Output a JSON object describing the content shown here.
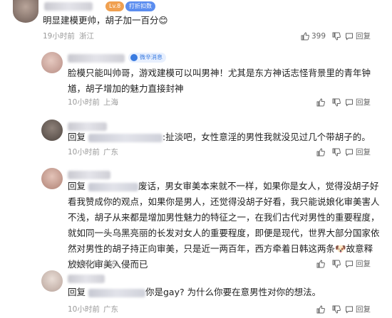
{
  "comments": [
    {
      "level_badge": "Lv.8",
      "tag_badge": "打折扣数",
      "text": "明显建模更帅，胡子加一百分",
      "emoji": "😊",
      "time": "19小时前",
      "location": "浙江",
      "likes": "399",
      "reply_label": "回复"
    },
    {
      "tag_badge": "微辛消息",
      "text": "脸模只能叫帅哥，游戏建模可以叫男神！尤其是东方神话志怪背景里的青年钟馗，胡子增加的魅力直接封神",
      "time": "10小时前",
      "location": "上海",
      "likes": "",
      "reply_label": "回复"
    },
    {
      "reply_prefix": "回复",
      "text": ":扯淡吧，女性意淫的男性我就没见过几个带胡子的。",
      "time": "10小时前",
      "location": "广东",
      "likes": "",
      "reply_label": "回复"
    },
    {
      "reply_prefix": "回复",
      "text": "废话，男女审美本来就不一样，如果你是女人，觉得没胡子好看我赞成你的观点，如果你是男人，还觉得没胡子好看，我只能说娘化审美害人不浅，胡子从来都是增加男性魅力的特征之一，在我们古代对男性的重要程度，就如同一头乌黑亮丽的长发对女人的重要程度，即便是现代，世界大部分国家依然对男性的胡子持正向审美，只是近一两百年，西方牵着日韩这两条",
      "text_tail": "故意释放娘化审美入侵而已",
      "emoji": "🐶",
      "time": "10小时前",
      "location": "广东",
      "likes": "",
      "reply_label": "回复"
    },
    {
      "reply_prefix": "回复",
      "text": "你是gay? 为什么你要在意男性对你的想法。",
      "time": "10小时前",
      "location": "广东",
      "likes": "",
      "reply_label": "回复"
    }
  ],
  "colors": {
    "badge_level": "#f0a050",
    "badge_tag": "#5b8def",
    "badge_tag2": "#5ba7ef",
    "meta": "#9a9a9a"
  }
}
